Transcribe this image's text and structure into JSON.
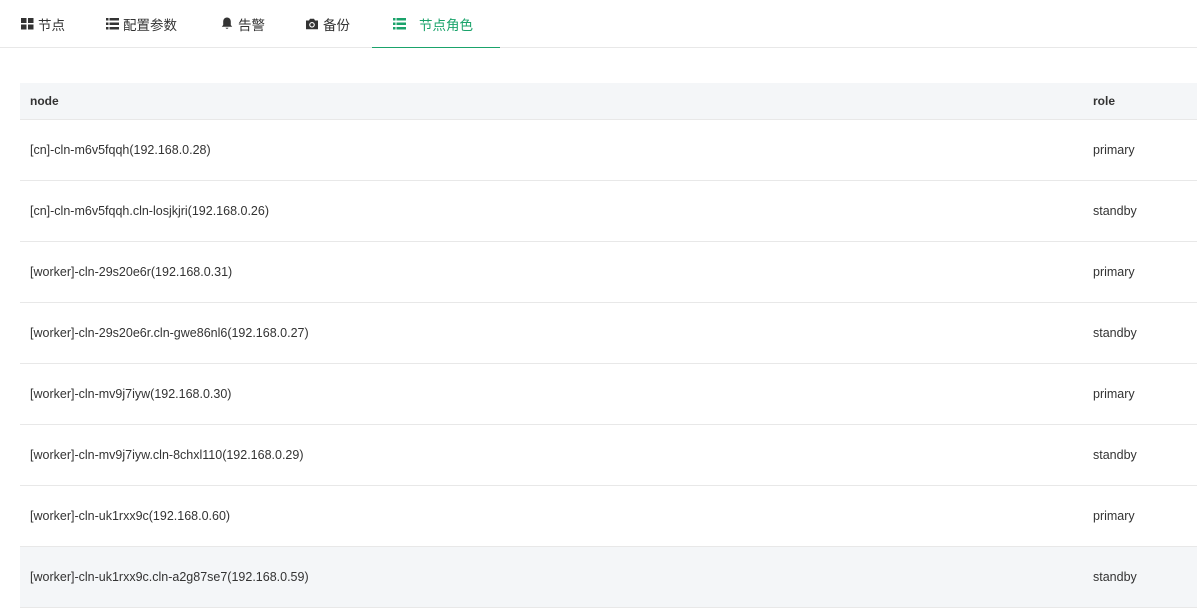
{
  "tabs": [
    {
      "label": "节点",
      "icon": "grid-icon"
    },
    {
      "label": "配置参数",
      "icon": "list-icon"
    },
    {
      "label": "告警",
      "icon": "bell-icon"
    },
    {
      "label": "备份",
      "icon": "camera-icon"
    },
    {
      "label": "节点角色",
      "icon": "list-icon",
      "active": true
    }
  ],
  "accent_color": "#1aa36b",
  "table": {
    "columns": [
      "node",
      "role"
    ],
    "rows": [
      {
        "node": "[cn]-cln-m6v5fqqh(192.168.0.28)",
        "role": "primary"
      },
      {
        "node": "[cn]-cln-m6v5fqqh.cln-losjkjri(192.168.0.26)",
        "role": "standby"
      },
      {
        "node": "[worker]-cln-29s20e6r(192.168.0.31)",
        "role": "primary"
      },
      {
        "node": "[worker]-cln-29s20e6r.cln-gwe86nl6(192.168.0.27)",
        "role": "standby"
      },
      {
        "node": "[worker]-cln-mv9j7iyw(192.168.0.30)",
        "role": "primary"
      },
      {
        "node": "[worker]-cln-mv9j7iyw.cln-8chxl110(192.168.0.29)",
        "role": "standby"
      },
      {
        "node": "[worker]-cln-uk1rxx9c(192.168.0.60)",
        "role": "primary"
      },
      {
        "node": "[worker]-cln-uk1rxx9c.cln-a2g87se7(192.168.0.59)",
        "role": "standby"
      }
    ]
  }
}
